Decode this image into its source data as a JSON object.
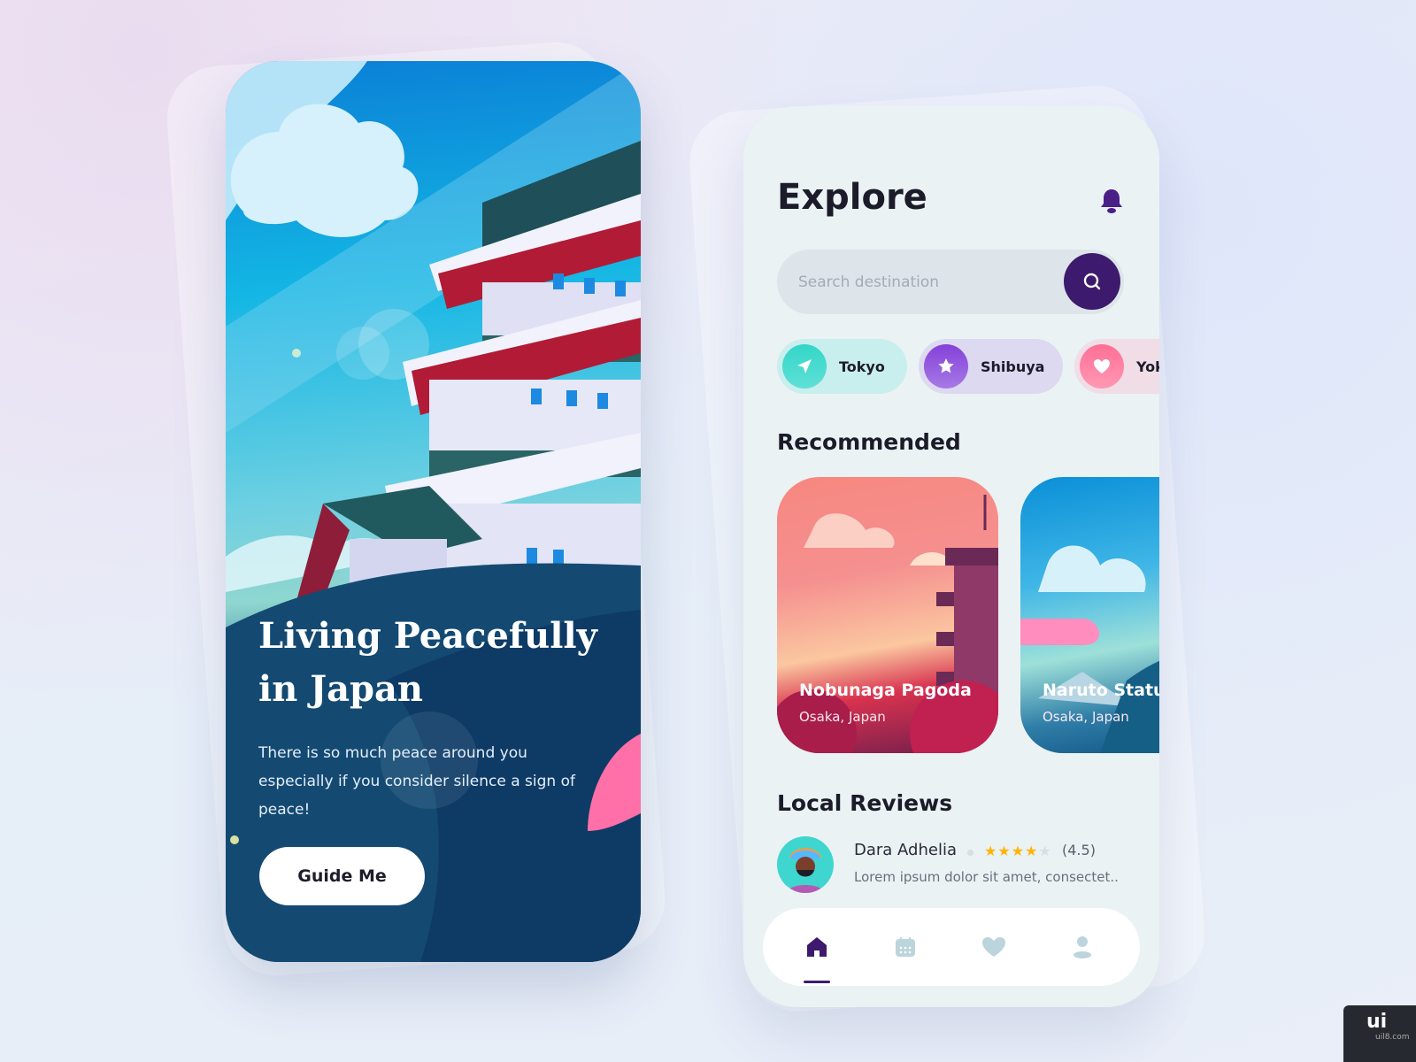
{
  "onboarding": {
    "title_line1": "Living Peacefully",
    "title_line2": "in Japan",
    "description": "There is so much peace around you especially if you consider silence a sign of peace!",
    "button_label": "Guide Me"
  },
  "explore": {
    "title": "Explore",
    "search_placeholder": "Search destination",
    "chips": [
      {
        "label": "Tokyo",
        "icon": "paper-plane-icon",
        "color": "#3dd6c9"
      },
      {
        "label": "Shibuya",
        "icon": "star-icon",
        "color": "#8a48dc"
      },
      {
        "label": "Yok",
        "icon": "heart-icon",
        "color": "#ff7a9e"
      }
    ],
    "recommended_title": "Recommended",
    "recommended": [
      {
        "title": "Nobunaga Pagoda",
        "location": "Osaka, Japan"
      },
      {
        "title": "Naruto Statu",
        "location": "Osaka, Japan"
      }
    ],
    "reviews_title": "Local Reviews",
    "review": {
      "name": "Dara Adhelia",
      "stars": 4,
      "rating": "(4.5)",
      "text": "Lorem ipsum dolor sit amet, consectet.."
    },
    "nav": [
      {
        "icon": "home-icon",
        "active": true
      },
      {
        "icon": "calendar-icon"
      },
      {
        "icon": "heart-icon"
      },
      {
        "icon": "user-icon"
      }
    ],
    "colors": {
      "accent": "#3d1a6e",
      "star": "#ffb400",
      "inactive_icon": "#bcd4dc"
    }
  },
  "watermark": {
    "text": "ui",
    "sub": "uil8.com"
  }
}
